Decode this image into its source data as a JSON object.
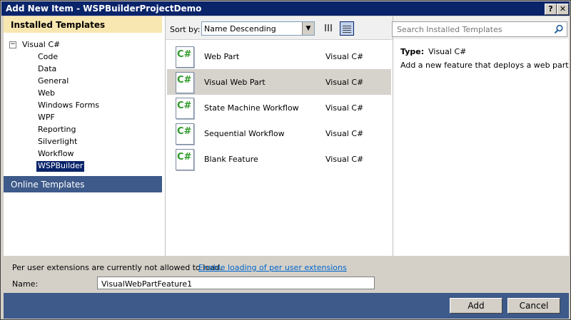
{
  "window": {
    "title": "Add New Item - WSPBuilderProjectDemo",
    "help_label": "?",
    "close_label": "✕"
  },
  "left": {
    "installed_header": "Installed Templates",
    "tree_root": {
      "expander": "−",
      "label": "Visual C#"
    },
    "items": [
      "Code",
      "Data",
      "General",
      "Web",
      "Windows Forms",
      "WPF",
      "Reporting",
      "Silverlight",
      "Workflow",
      "WSPBuilder"
    ],
    "selected_index": 9,
    "online_header": "Online Templates"
  },
  "sortbar": {
    "label": "Sort by:",
    "value": "Name Descending",
    "dropdown_arrow": "▼"
  },
  "templates": [
    {
      "icon_text": "C#",
      "name": "Web Part",
      "lang": "Visual C#"
    },
    {
      "icon_text": "C#",
      "name": "Visual Web Part",
      "lang": "Visual C#"
    },
    {
      "icon_text": "C#",
      "name": "State Machine Workflow",
      "lang": "Visual C#"
    },
    {
      "icon_text": "C#",
      "name": "Sequential Workflow",
      "lang": "Visual C#"
    },
    {
      "icon_text": "C#",
      "name": "Blank Feature",
      "lang": "Visual C#"
    }
  ],
  "selected_template_index": 1,
  "search": {
    "placeholder": "Search Installed Templates"
  },
  "details": {
    "type_label": "Type:",
    "type_value": "Visual C#",
    "description": "Add a new feature that deploys a web part"
  },
  "bottom": {
    "extensions_msg": "Per user extensions are currently not allowed to load.",
    "extensions_link": "Enable loading of per user extensions",
    "name_label": "Name:",
    "name_value": "VisualWebPartFeature1"
  },
  "buttons": {
    "add": "Add",
    "cancel": "Cancel"
  }
}
